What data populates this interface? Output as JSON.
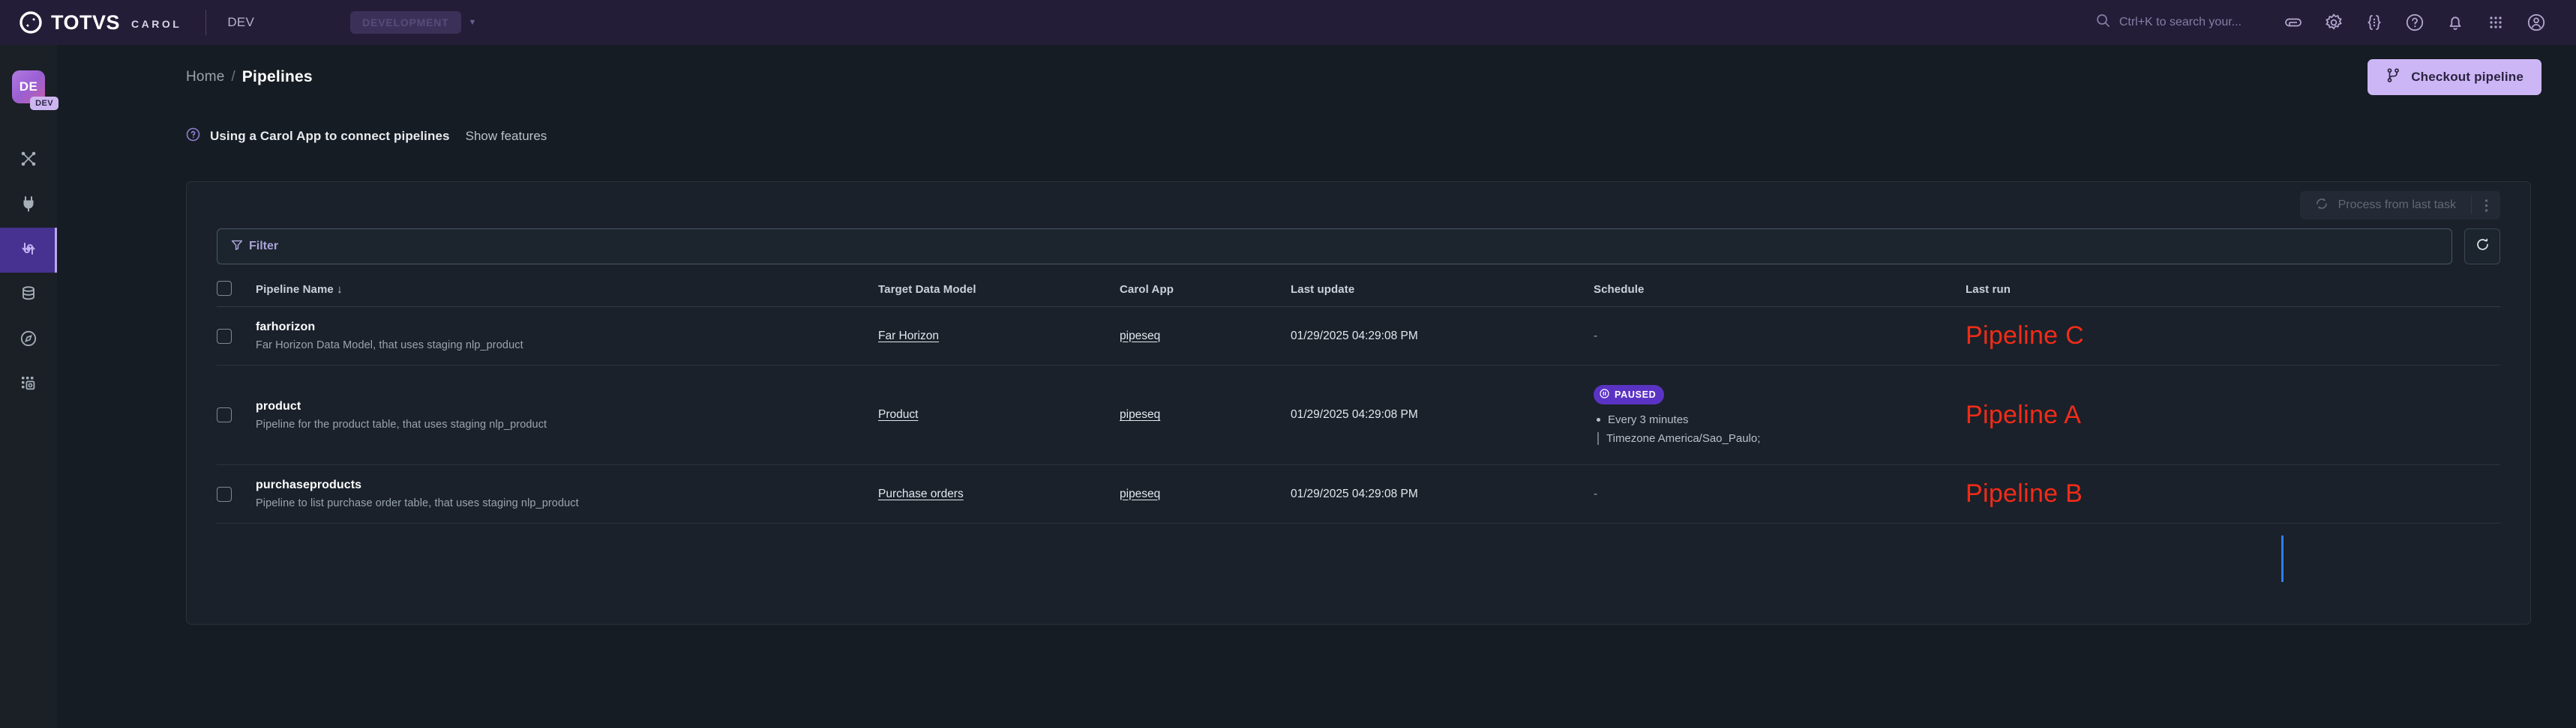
{
  "topbar": {
    "brand_primary": "TOTVS",
    "brand_secondary": "CAROL",
    "environment": "DEV",
    "env_chip": "DEVELOPMENT",
    "env_caret": "▼",
    "search_placeholder": "Ctrl+K to search your...",
    "icons": [
      "link-icon",
      "gear-icon",
      "code-braces-icon",
      "help-circle-icon",
      "bell-icon",
      "apps-grid-icon",
      "user-account-icon"
    ]
  },
  "rail": {
    "avatar_initials": "DE",
    "avatar_badge": "DEV",
    "items": [
      {
        "name": "connectors",
        "icon": "shuffle-icon",
        "active": false
      },
      {
        "name": "data-incoming",
        "icon": "plug-icon",
        "active": false
      },
      {
        "name": "pipelines",
        "icon": "pipelines-arrows-icon",
        "active": true
      },
      {
        "name": "data-models",
        "icon": "database-icon",
        "active": false
      },
      {
        "name": "explore",
        "icon": "compass-icon",
        "active": false
      },
      {
        "name": "apps",
        "icon": "apps-chip-icon",
        "active": false
      }
    ]
  },
  "header": {
    "breadcrumb_home": "Home",
    "breadcrumb_sep": "/",
    "breadcrumb_current": "Pipelines",
    "checkout_label": "Checkout pipeline",
    "checkout_icon": "git-branch-icon"
  },
  "notice": {
    "icon": "help-circle-icon",
    "text": "Using a Carol App to connect pipelines",
    "link": "Show features"
  },
  "toolbar": {
    "process_label": "Process from last task",
    "process_icon": "refresh-cycle-icon",
    "kebab_icon": "kebab-menu-icon"
  },
  "filter": {
    "label": "Filter",
    "icon": "funnel-icon",
    "value": "",
    "placeholder": "",
    "refresh_icon": "refresh-icon"
  },
  "table": {
    "columns": [
      {
        "key": "checkbox",
        "label": ""
      },
      {
        "key": "name",
        "label": "Pipeline Name",
        "sort": "↓"
      },
      {
        "key": "target_data_model",
        "label": "Target Data Model"
      },
      {
        "key": "carol_app",
        "label": "Carol App"
      },
      {
        "key": "last_update",
        "label": "Last update"
      },
      {
        "key": "schedule",
        "label": "Schedule"
      },
      {
        "key": "last_run",
        "label": "Last run"
      }
    ],
    "rows": [
      {
        "name": "farhorizon",
        "description": "Far Horizon Data Model, that uses staging nlp_product",
        "target_data_model": "Far Horizon",
        "carol_app": "pipeseq",
        "last_update": "01/29/2025 04:29:08 PM",
        "schedule_dash": "-",
        "schedule_badge": "",
        "schedule_every": "",
        "schedule_timezone": "",
        "annotation": "Pipeline C"
      },
      {
        "name": "product",
        "description": "Pipeline for the product table, that uses staging nlp_product",
        "target_data_model": "Product",
        "carol_app": "pipeseq",
        "last_update": "01/29/2025 04:29:08 PM",
        "schedule_dash": "",
        "schedule_badge": "PAUSED",
        "schedule_every": "Every 3 minutes",
        "schedule_timezone": "Timezone America/Sao_Paulo;",
        "annotation": "Pipeline A"
      },
      {
        "name": "purchaseproducts",
        "description": "Pipeline to list purchase order table, that uses staging nlp_product",
        "target_data_model": "Purchase orders",
        "carol_app": "pipeseq",
        "last_update": "01/29/2025 04:29:08 PM",
        "schedule_dash": "-",
        "schedule_badge": "",
        "schedule_every": "",
        "schedule_timezone": "",
        "annotation": "Pipeline B"
      }
    ]
  },
  "colors": {
    "topbar_bg": "#241d38",
    "rail_bg": "#1b2027",
    "page_bg": "#161c23",
    "accent_purple": "#cdb6f5",
    "active_nav": "#473191",
    "badge_paused": "#5b33c4",
    "annotation_red": "#f02c18",
    "caret_blue": "#2e7df6"
  }
}
